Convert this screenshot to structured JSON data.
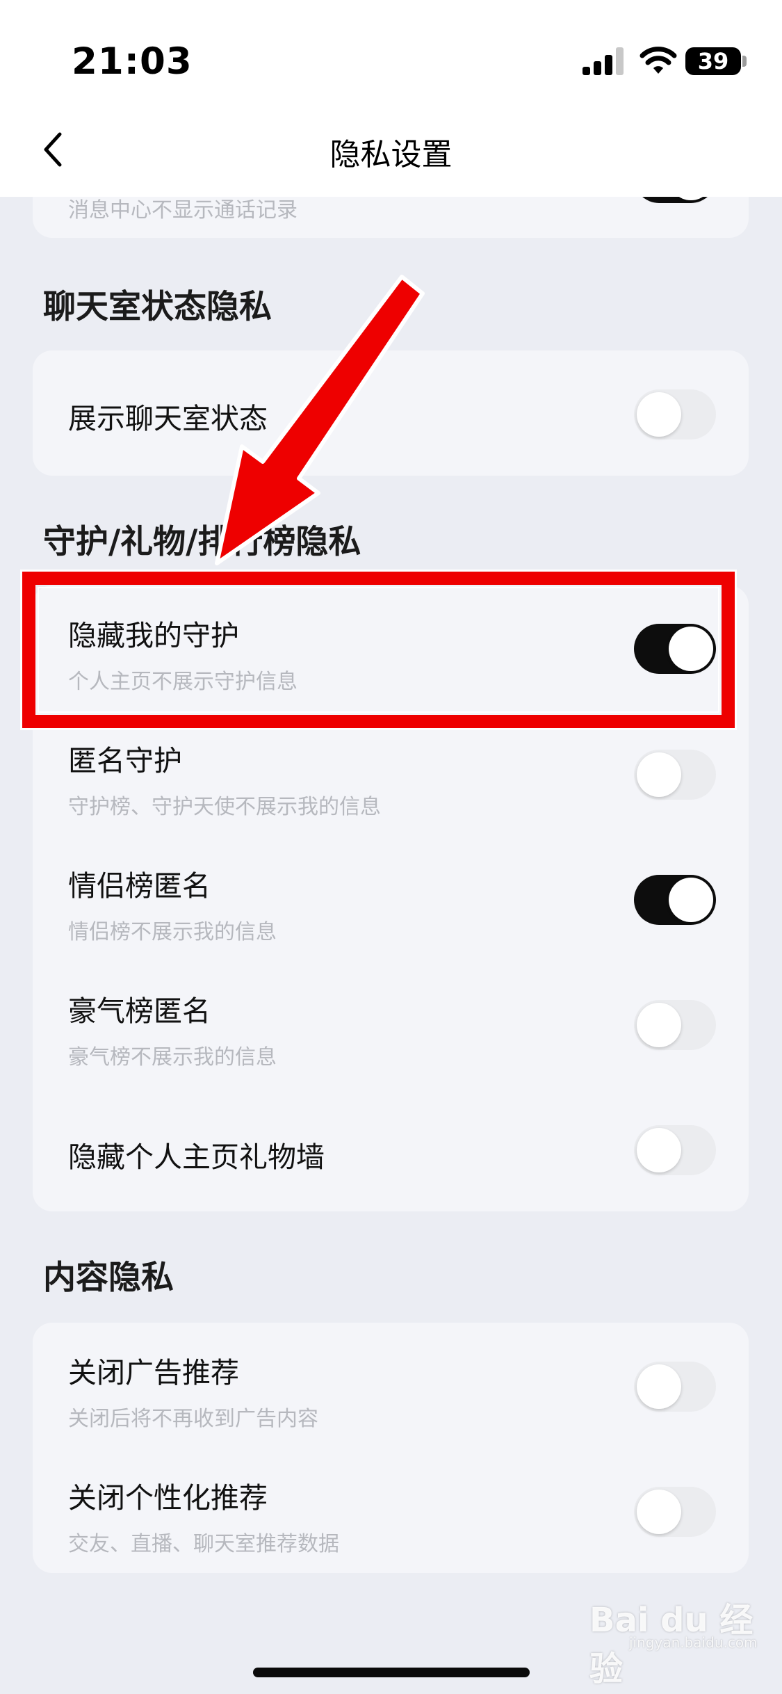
{
  "status_bar": {
    "time": "21:03",
    "battery": "39"
  },
  "nav": {
    "title": "隐私设置"
  },
  "top_card": {
    "subtitle": "消息中心不显示通话记录",
    "toggle_on": true
  },
  "sections": {
    "chatroom": {
      "title": "聊天室状态隐私",
      "items": [
        {
          "title": "展示聊天室状态",
          "on": false
        }
      ]
    },
    "guard": {
      "title": "守护/礼物/排行榜隐私",
      "items": [
        {
          "title": "隐藏我的守护",
          "subtitle": "个人主页不展示守护信息",
          "on": true
        },
        {
          "title": "匿名守护",
          "subtitle": "守护榜、守护天使不展示我的信息",
          "on": false
        },
        {
          "title": "情侣榜匿名",
          "subtitle": "情侣榜不展示我的信息",
          "on": true
        },
        {
          "title": "豪气榜匿名",
          "subtitle": "豪气榜不展示我的信息",
          "on": false
        },
        {
          "title": "隐藏个人主页礼物墙",
          "on": false
        }
      ]
    },
    "content": {
      "title": "内容隐私",
      "items": [
        {
          "title": "关闭广告推荐",
          "subtitle": "关闭后将不再收到广告内容",
          "on": false
        },
        {
          "title": "关闭个性化推荐",
          "subtitle": "交友、直播、聊天室推荐数据",
          "on": false
        }
      ]
    }
  },
  "watermark": {
    "brand": "Bai du 经验",
    "url": "jingyan.baidu.com"
  },
  "colors": {
    "annotation": "#ee0000",
    "toggle_on": "#0d0d0d",
    "toggle_off": "#ebecef"
  }
}
